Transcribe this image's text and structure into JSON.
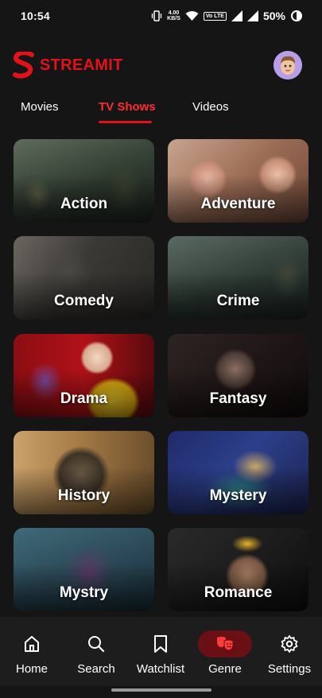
{
  "status_bar": {
    "time": "10:54",
    "net_speed_value": "4.00",
    "net_speed_unit": "KB/S",
    "volte": "Vo LTE",
    "battery": "50%"
  },
  "header": {
    "brand_letter": "S",
    "brand_name": "STREAMIT",
    "brand_color": "#e1121a",
    "avatar_icon": "user-avatar"
  },
  "tabs": [
    {
      "label": "Movies",
      "active": false
    },
    {
      "label": "TV Shows",
      "active": true
    },
    {
      "label": "Videos",
      "active": false
    }
  ],
  "genres": [
    {
      "label": "Action"
    },
    {
      "label": "Adventure"
    },
    {
      "label": "Comedy"
    },
    {
      "label": "Crime"
    },
    {
      "label": "Drama"
    },
    {
      "label": "Fantasy"
    },
    {
      "label": "History"
    },
    {
      "label": "Mystery"
    },
    {
      "label": "Mystry"
    },
    {
      "label": "Romance"
    }
  ],
  "bottom_nav": [
    {
      "label": "Home",
      "icon": "home-icon",
      "active": false
    },
    {
      "label": "Search",
      "icon": "search-icon",
      "active": false
    },
    {
      "label": "Watchlist",
      "icon": "bookmark-icon",
      "active": false
    },
    {
      "label": "Genre",
      "icon": "theater-masks-icon",
      "active": true
    },
    {
      "label": "Settings",
      "icon": "gear-icon",
      "active": false
    }
  ],
  "colors": {
    "background": "#151515",
    "accent": "#e1121a",
    "active_tab_text": "#ff2d2d",
    "nav_background": "#1d1d1d",
    "genre_pill": "#6a0f14"
  }
}
